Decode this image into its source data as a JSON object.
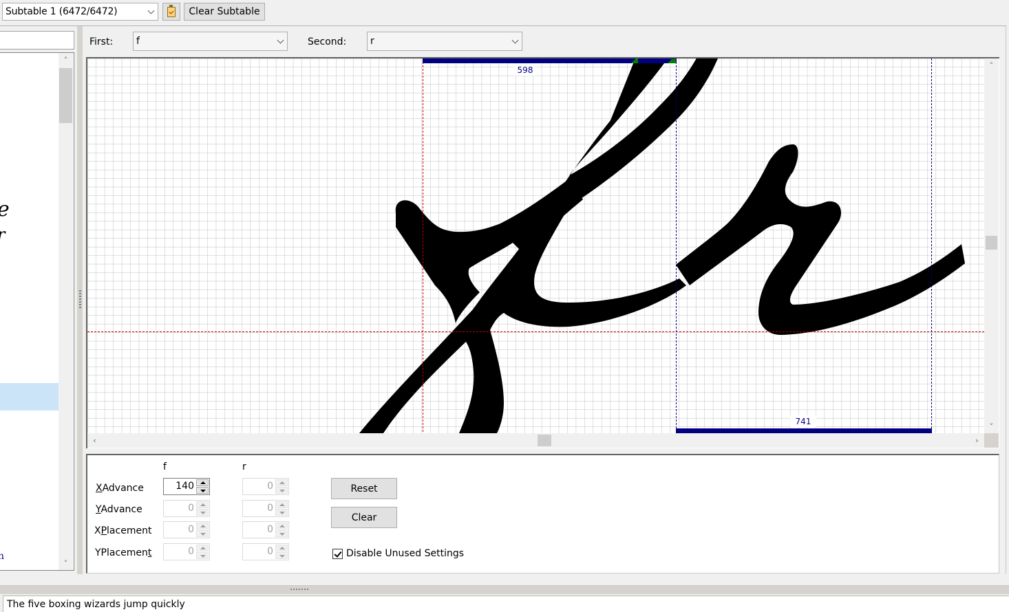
{
  "toolbar": {
    "subtable_select": "Subtable 1 (6472/6472)",
    "clipboard_icon": "clipboard-check-icon",
    "clear_subtable_label": "Clear Subtable"
  },
  "pair": {
    "first_label": "First:",
    "first_value": "f",
    "second_label": "Second:",
    "second_value": "r"
  },
  "canvas": {
    "first_advance_label": "598",
    "second_advance_label": "741",
    "colors": {
      "advance_bar": "#000080",
      "baseline": "#c00000",
      "grid": "#c0c0c0",
      "glyph": "#000000",
      "kern_marker": "#008000"
    }
  },
  "settings": {
    "col_first": "f",
    "col_second": "r",
    "rows": [
      {
        "label": "XAdvance",
        "mnemonic": "X",
        "rest": "Advance",
        "first": "140",
        "second": "0",
        "first_enabled": true
      },
      {
        "label": "YAdvance",
        "mnemonic": "Y",
        "rest": "Advance",
        "first": "0",
        "second": "0",
        "first_enabled": false
      },
      {
        "label": "XPlacement",
        "pre": "X",
        "mnemonic": "P",
        "rest": "lacement",
        "first": "0",
        "second": "0",
        "first_enabled": false
      },
      {
        "label": "YPlacement",
        "pre": "YPlacemen",
        "mnemonic": "t",
        "rest": "",
        "first": "0",
        "second": "0",
        "first_enabled": false
      }
    ],
    "reset_label": "Reset",
    "clear_label": "Clear",
    "disable_unused_label": "Disable Unused Settings",
    "disable_unused_checked": true
  },
  "sample_text": "The five boxing wizards jump quickly"
}
